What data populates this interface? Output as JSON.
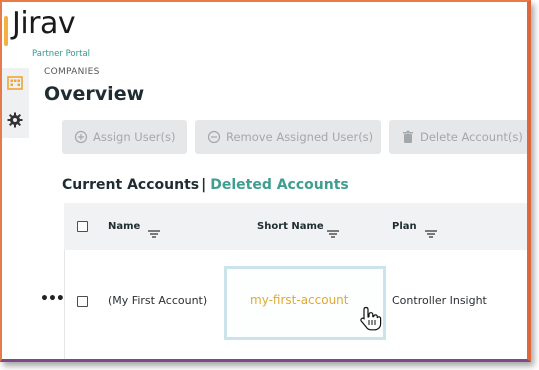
{
  "logo": {
    "wordmark": "Jirav",
    "subtitle": "Partner Portal"
  },
  "side_nav": [
    {
      "icon": "building-icon"
    },
    {
      "icon": "gear-icon"
    }
  ],
  "breadcrumb": "COMPANIES",
  "page_title": "Overview",
  "toolbar": {
    "assign_label": "Assign User(s)",
    "remove_label": "Remove Assigned User(s)",
    "delete_label": "Delete Account(s)"
  },
  "accounts_tabs": {
    "current_label": "Current Accounts",
    "separator": "|",
    "deleted_label": "Deleted Accounts"
  },
  "table": {
    "columns": [
      {
        "label": "Name"
      },
      {
        "label": "Short Name"
      },
      {
        "label": "Plan"
      }
    ],
    "rows": [
      {
        "actions": "•••",
        "name": "(My First Account)",
        "short_name": "my-first-account",
        "plan": "Controller Insight"
      }
    ]
  },
  "colors": {
    "frame_border": "#e57a4a",
    "link_teal": "#3e9e8f",
    "short_name_gold": "#e1a934",
    "highlight_border": "#cde3ec"
  }
}
